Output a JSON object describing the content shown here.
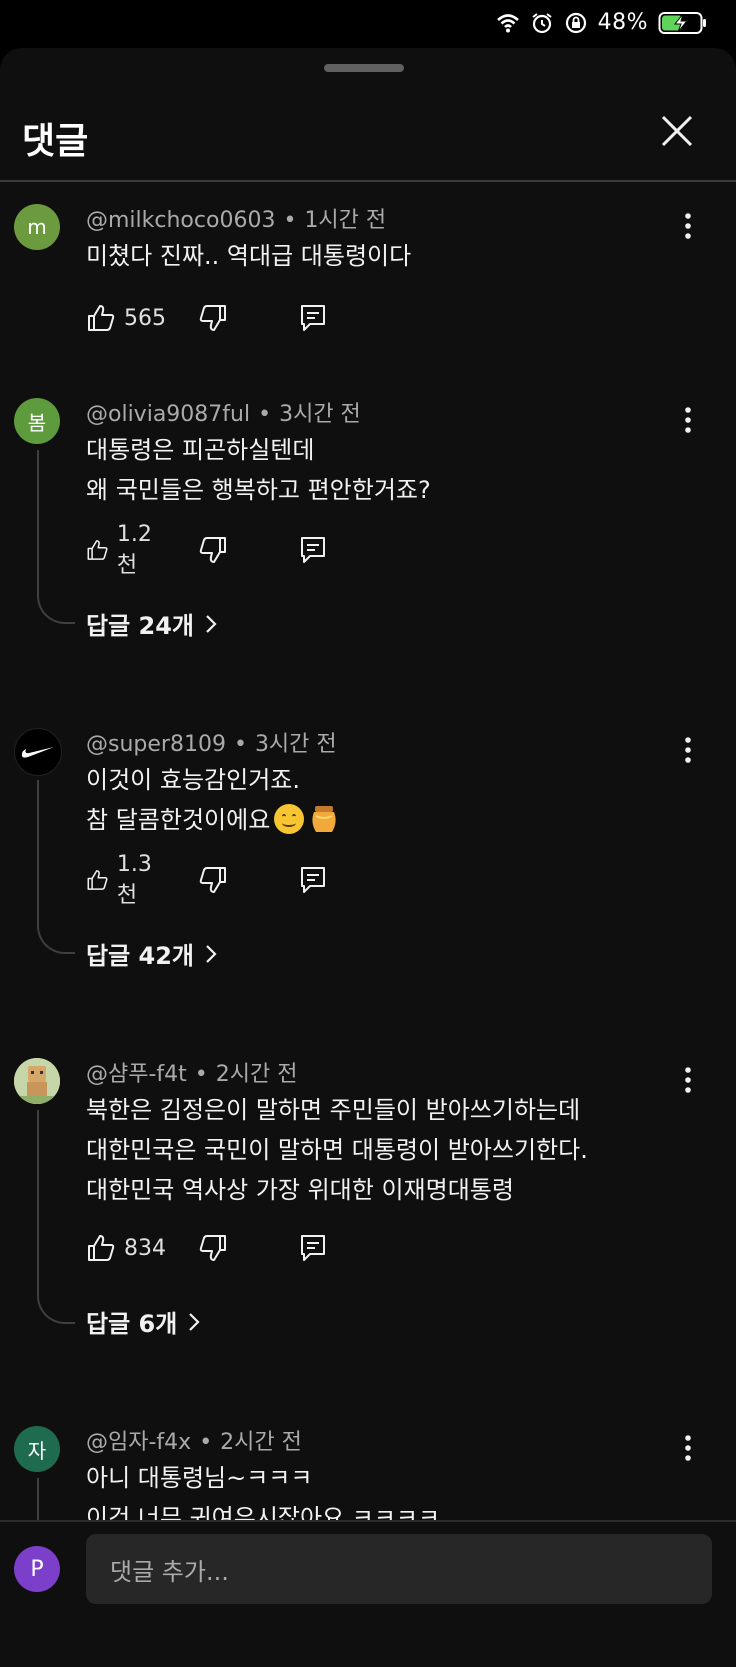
{
  "status_bar": {
    "battery": "48%"
  },
  "header": {
    "title": "댓글"
  },
  "comments": [
    {
      "avatar_letter": "m",
      "avatar_color": "#6c9a3e",
      "author": "@milkchoco0603",
      "time": "1시간 전",
      "lines": [
        "미쳤다 진짜.. 역대급 대통령이다"
      ],
      "likes": "565"
    },
    {
      "avatar_letter": "봄",
      "avatar_color": "#5e9b3d",
      "author": "@olivia9087ful",
      "time": "3시간 전",
      "lines": [
        "대통령은 피곤하실텐데",
        "왜 국민들은 행복하고 편안한거죠?"
      ],
      "likes": "1.2천",
      "replies": "답글 24개"
    },
    {
      "avatar_letter": "",
      "avatar_color": "#000000",
      "author": "@super8109",
      "time": "3시간 전",
      "lines": [
        "이것이 효능감인거죠.",
        "참 달콤한것이에요"
      ],
      "likes": "1.3천",
      "replies": "답글 42개"
    },
    {
      "avatar_letter": "",
      "avatar_color": "#c7d6a8",
      "author": "@샴푸-f4t",
      "time": "2시간 전",
      "lines": [
        "북한은 김정은이 말하면 주민들이 받아쓰기하는데",
        "대한민국은 국민이 말하면 대통령이 받아쓰기한다.",
        "대한민국 역사상 가장 위대한 이재명대통령"
      ],
      "likes": "834",
      "replies": "답글 6개"
    },
    {
      "avatar_letter": "자",
      "avatar_color": "#1f6b4f",
      "author": "@임자-f4x",
      "time": "2시간 전",
      "lines": [
        "아니 대통령님~ㅋㅋㅋ",
        "이건 너무 귀여우시잖아요 ㅋㅋㅋㅋ"
      ],
      "likes": ""
    }
  ],
  "composer": {
    "avatar_letter": "P",
    "placeholder": "댓글 추가..."
  }
}
